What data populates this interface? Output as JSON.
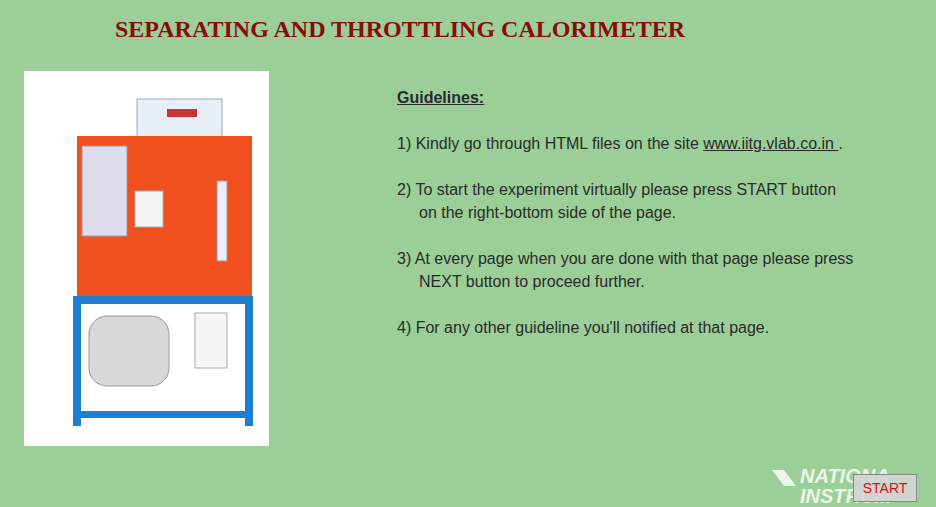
{
  "title": "SEPARATING AND THROTTLING CALORIMETER",
  "guidelines": {
    "heading": "Guidelines:",
    "items": [
      {
        "lines": [
          "1) Kindly go through HTML files on the site "
        ],
        "link": "www.iitg.vlab.co.in ",
        "suffix": "."
      },
      {
        "lines": [
          "2) To start the experiment virtually please press START button",
          "on the right-bottom side of the page."
        ],
        "link": "",
        "suffix": ""
      },
      {
        "lines": [
          "3) At every page when you are done with that page please press",
          "NEXT button to proceed further."
        ],
        "link": "",
        "suffix": ""
      },
      {
        "lines": [
          "4) For any other guideline you'll notified at that page."
        ],
        "link": "",
        "suffix": ""
      }
    ]
  },
  "watermark": [
    "NATIONA",
    "INSTRUM"
  ],
  "buttons": [
    "START"
  ]
}
